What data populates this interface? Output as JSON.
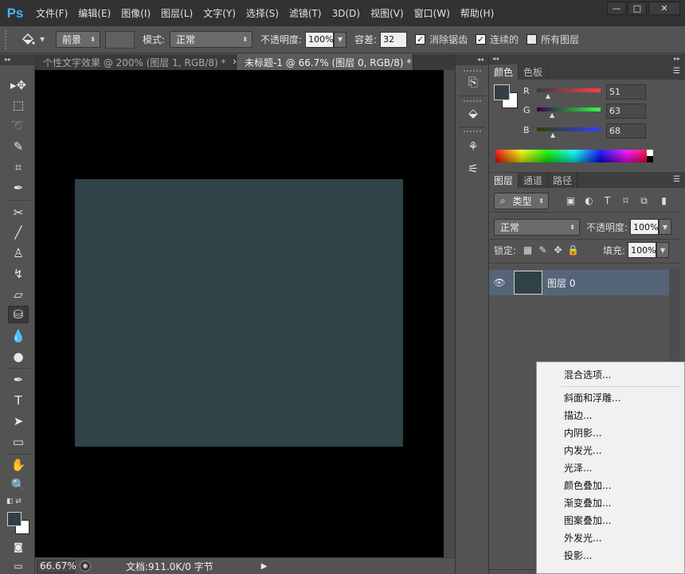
{
  "app": {
    "logo": "Ps"
  },
  "menubar": {
    "items": [
      "文件(F)",
      "编辑(E)",
      "图像(I)",
      "图层(L)",
      "文字(Y)",
      "选择(S)",
      "滤镜(T)",
      "3D(D)",
      "视图(V)",
      "窗口(W)",
      "帮助(H)"
    ],
    "window_buttons": {
      "minimize": "—",
      "maximize": "□",
      "close": "✕"
    }
  },
  "options": {
    "fill_source": "前景",
    "mode_label": "模式:",
    "mode_value": "正常",
    "opacity_label": "不透明度:",
    "opacity_value": "100%",
    "tolerance_label": "容差:",
    "tolerance_value": "32",
    "antialias_label": "消除锯齿",
    "antialias_checked": true,
    "contiguous_label": "连续的",
    "contiguous_checked": true,
    "all_layers_label": "所有图层",
    "all_layers_checked": false
  },
  "tools": {
    "items": [
      "move-tool",
      "marquee-tool",
      "lasso-tool",
      "quick-selection-tool",
      "crop-tool",
      "eyedropper-tool",
      "spot-healing-tool",
      "brush-tool",
      "clone-stamp-tool",
      "history-brush-tool",
      "eraser-tool",
      "paint-bucket-tool",
      "blur-tool",
      "dodge-tool",
      "pen-tool",
      "type-tool",
      "path-selection-tool",
      "rectangle-tool",
      "hand-tool",
      "zoom-tool"
    ],
    "active": "paint-bucket-tool",
    "glyphs": {
      "move": "▸✥",
      "marquee": "⬚",
      "lasso": "➰",
      "quick_select": "✎",
      "crop": "⌗",
      "eyedropper": "✒",
      "healing": "✂",
      "brush": "╱",
      "stamp": "♙",
      "history": "↯",
      "eraser": "▱",
      "bucket": "⛁",
      "blur": "💧",
      "dodge": "●",
      "pen": "✒",
      "type": "T",
      "path_select": "➤",
      "rect": "▭",
      "hand": "✋",
      "zoom": "🔍",
      "quickmask": "◙",
      "screenmode": "▭"
    }
  },
  "documents": {
    "tabs": [
      {
        "title": "个性文字效果 @ 200% (图层 1, RGB/8) *",
        "active": false
      },
      {
        "title": "未标题-1 @ 66.7% (图层 0, RGB/8) *",
        "active": true
      }
    ],
    "close_glyph": "✕"
  },
  "canvas": {
    "fill_color": "#2f4246",
    "background": "#000000"
  },
  "status": {
    "zoom": "66.67%",
    "doc_info": "文档:911.0K/0 字节",
    "arrow": "▶"
  },
  "color_panel": {
    "tabs": [
      "颜色",
      "色板"
    ],
    "r_label": "R",
    "g_label": "G",
    "b_label": "B",
    "r": "51",
    "g": "63",
    "b": "68",
    "foreground": "#333f44",
    "background": "#ffffff"
  },
  "layers_panel": {
    "tabs": [
      "图层",
      "通道",
      "路径"
    ],
    "filter_kind": "类型",
    "blend_mode": "正常",
    "opacity_label": "不透明度:",
    "opacity_value": "100%",
    "lock_label": "锁定:",
    "fill_label": "填充:",
    "fill_value": "100%",
    "layers": [
      {
        "name": "图层 0",
        "visible": true,
        "selected": true
      }
    ]
  },
  "context_menu": {
    "items": [
      "混合选项...",
      "斜面和浮雕...",
      "描边...",
      "内阴影...",
      "内发光...",
      "光泽...",
      "颜色叠加...",
      "渐变叠加...",
      "图案叠加...",
      "外发光...",
      "投影..."
    ]
  }
}
